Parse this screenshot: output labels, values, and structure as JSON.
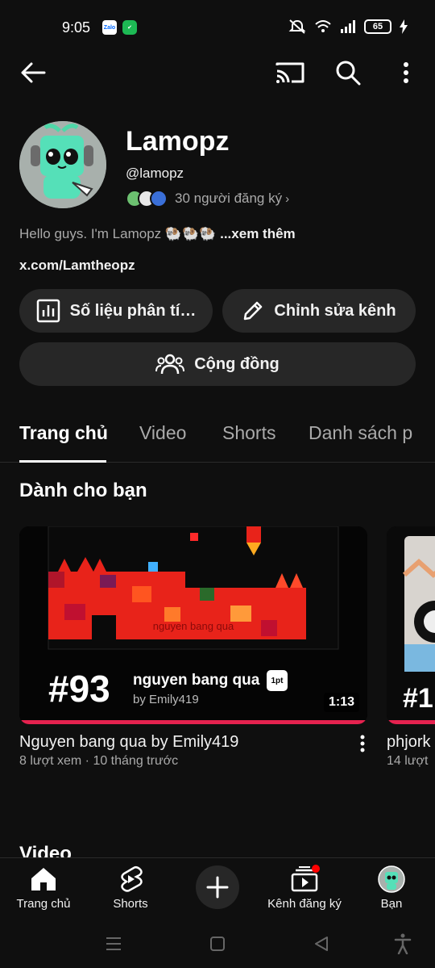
{
  "status_bar": {
    "time": "9:05",
    "zalo_label": "Zalo",
    "battery": "65"
  },
  "top_bar": {
    "icons": [
      "back-arrow-icon",
      "cast-icon",
      "search-icon",
      "more-vert-icon"
    ]
  },
  "channel": {
    "name": "Lamopz",
    "handle": "@lamopz",
    "subscribers": "30 người đăng ký",
    "description": "Hello guys. I'm Lamopz 🐏🐏🐏",
    "description_more": "...xem thêm",
    "link": "x.com/Lamtheopz"
  },
  "actions": {
    "analytics": "Số liệu phân tí…",
    "edit": "Chỉnh sửa kênh",
    "community": "Cộng đồng"
  },
  "tabs": [
    {
      "label": "Trang chủ",
      "active": true
    },
    {
      "label": "Video",
      "active": false
    },
    {
      "label": "Shorts",
      "active": false
    },
    {
      "label": "Danh sách p",
      "active": false
    }
  ],
  "section": {
    "title": "Dành cho bạn",
    "next_title": "Video"
  },
  "videos": [
    {
      "rank": "#93",
      "song": "nguyen bang qua",
      "tag": "1pt",
      "by": "by Emily419",
      "duration": "1:13",
      "title": "Nguyen bang qua by Emily419",
      "meta": "8 lượt xem · 10 tháng trước"
    },
    {
      "rank": "#1",
      "title": "phjork",
      "meta": "14 lượt"
    }
  ],
  "bottom_nav": [
    {
      "label": "Trang chủ",
      "icon": "home-icon"
    },
    {
      "label": "Shorts",
      "icon": "shorts-icon"
    },
    {
      "label": "",
      "icon": "create-icon"
    },
    {
      "label": "Kênh đăng ký",
      "icon": "subscriptions-icon"
    },
    {
      "label": "Bạn",
      "icon": "avatar"
    }
  ],
  "colors": {
    "background": "#0f0f0f",
    "pill": "#272727",
    "progress": "#e5224f",
    "notification": "#ff0000"
  }
}
